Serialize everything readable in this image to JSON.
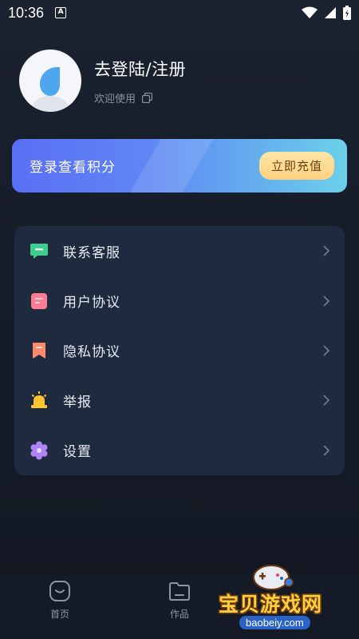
{
  "status_bar": {
    "time": "10:36",
    "a_badge": "A"
  },
  "profile": {
    "title": "去登陆/注册",
    "welcome": "欢迎使用"
  },
  "points": {
    "label": "登录查看积分",
    "button": "立即充值"
  },
  "menu": {
    "items": [
      {
        "label": "联系客服",
        "icon": "chat-icon",
        "color": "#3ecf8e"
      },
      {
        "label": "用户协议",
        "icon": "document-icon",
        "color": "#ff7b94"
      },
      {
        "label": "隐私协议",
        "icon": "bookmark-icon",
        "color": "#ff8a6b"
      },
      {
        "label": "举报",
        "icon": "alarm-icon",
        "color": "#ffc531"
      },
      {
        "label": "设置",
        "icon": "gear-icon",
        "color": "#b084f5"
      }
    ]
  },
  "tabbar": {
    "tabs": [
      {
        "label": "首页"
      },
      {
        "label": "作品"
      }
    ]
  },
  "watermark": {
    "text": "宝贝游戏网",
    "url": "baobeiy.com"
  }
}
